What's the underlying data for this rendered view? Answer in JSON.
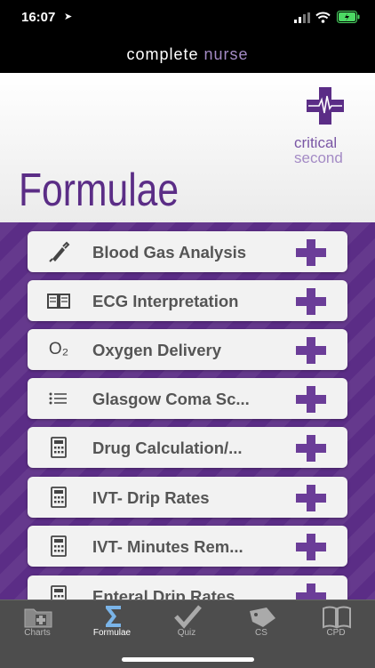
{
  "status_bar": {
    "time": "16:07",
    "location_arrow": "➤"
  },
  "app_bar": {
    "brand_main": "complete",
    "brand_accent": "nurse"
  },
  "header": {
    "title": "Formulae",
    "logo_line1": "critical",
    "logo_line2": "second"
  },
  "menu": {
    "items": [
      {
        "label": "Blood Gas Analysis",
        "icon": "syringe-icon"
      },
      {
        "label": "ECG Interpretation",
        "icon": "book-icon"
      },
      {
        "label": "Oxygen Delivery",
        "icon": "o2-icon",
        "icon_text": "O₂"
      },
      {
        "label": "Glasgow Coma Sc...",
        "icon": "list-icon"
      },
      {
        "label": "Drug Calculation/...",
        "icon": "calculator-icon"
      },
      {
        "label": "IVT- Drip Rates",
        "icon": "calculator-icon"
      },
      {
        "label": "IVT- Minutes Rem...",
        "icon": "calculator-icon"
      },
      {
        "label": "Enteral Drip Rates",
        "icon": "calculator-icon"
      }
    ]
  },
  "tab_bar": {
    "tabs": [
      {
        "label": "Charts",
        "icon": "charts-folder-icon"
      },
      {
        "label": "Formulae",
        "icon": "sigma-icon",
        "active": true
      },
      {
        "label": "Quiz",
        "icon": "checkmark-icon"
      },
      {
        "label": "CS",
        "icon": "tag-icon"
      },
      {
        "label": "CPD",
        "icon": "open-book-icon"
      }
    ]
  },
  "colors": {
    "brand_purple": "#5b2d86",
    "accent_light_purple": "#a48bc5",
    "plus_purple": "#6b3d98",
    "battery_green": "#4cd964"
  }
}
